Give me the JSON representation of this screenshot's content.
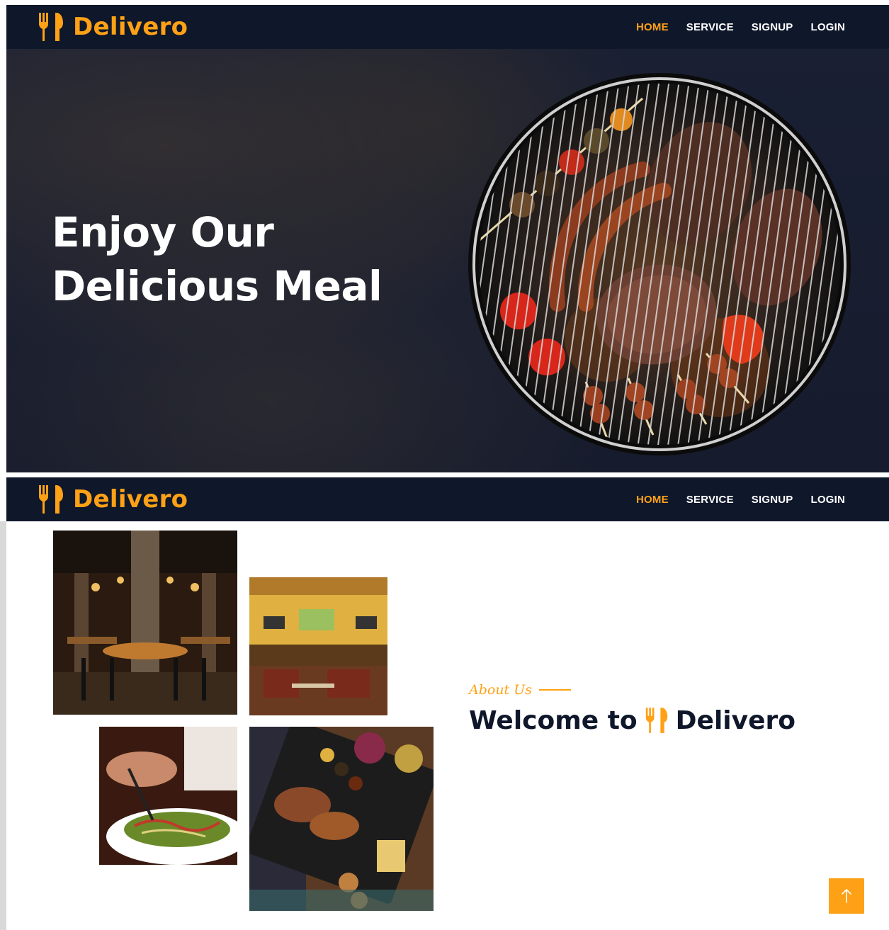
{
  "brand": {
    "name": "Delivero",
    "icon": "utensils-icon",
    "color": "#fea116"
  },
  "nav": {
    "items": [
      {
        "label": "HOME",
        "active": true
      },
      {
        "label": "SERVICE",
        "active": false
      },
      {
        "label": "SIGNUP",
        "active": false
      },
      {
        "label": "LOGIN",
        "active": false
      }
    ],
    "background": "#0f172b",
    "active_color": "#fea116"
  },
  "hero": {
    "title_line1": "Enjoy Our",
    "title_line2": "Delicious Meal",
    "image": "grilled-meat-barbecue"
  },
  "about": {
    "subtitle": "About Us",
    "heading_prefix": "Welcome to",
    "heading_brand": "Delivero",
    "images": [
      "restaurant-interior-dark",
      "restaurant-interior-bright",
      "salad-plate",
      "food-platter"
    ]
  },
  "back_to_top": {
    "icon": "arrow-up-icon"
  }
}
